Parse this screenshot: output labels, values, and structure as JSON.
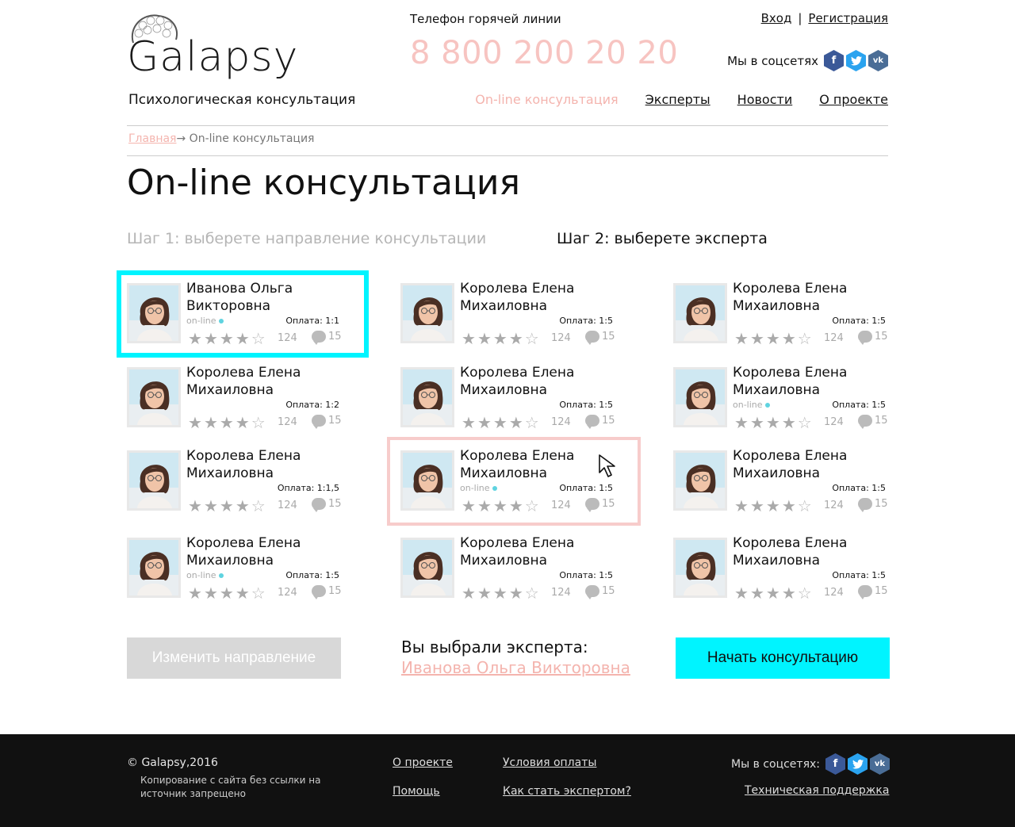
{
  "brand": {
    "name": "Galapsy",
    "tagline": "Психологическая консультация"
  },
  "hotline": {
    "label": "Телефон горячей линии",
    "phone": "8 800 200 20 20"
  },
  "auth": {
    "login": "Вход",
    "separator": "|",
    "register": "Регистрация"
  },
  "social": {
    "label": "Мы в соцсетях",
    "networks": [
      "facebook-icon",
      "twitter-icon",
      "vk-icon"
    ]
  },
  "nav": {
    "items": [
      {
        "label": "On-line консультация",
        "active": true
      },
      {
        "label": "Эксперты",
        "active": false
      },
      {
        "label": "Новости",
        "active": false
      },
      {
        "label": "О проекте",
        "active": false
      }
    ]
  },
  "breadcrumb": {
    "home": "Главная",
    "arrow": "→",
    "current": "On-line консультация"
  },
  "page": {
    "title": "On-line консультация",
    "step1": "Шаг 1: выберете направление консультации",
    "step2": "Шаг 2: выберете эксперта"
  },
  "experts": [
    {
      "name": "Иванова Ольга Викторовна",
      "online": true,
      "online_label": "on-line",
      "pay": "Оплата: 1:1",
      "rating": 4,
      "votes": "124",
      "comments": "15"
    },
    {
      "name": "Королева Елена Михаиловна",
      "online": false,
      "online_label": "",
      "pay": "Оплата: 1:5",
      "rating": 4,
      "votes": "124",
      "comments": "15"
    },
    {
      "name": "Королева Елена Михаиловна",
      "online": false,
      "online_label": "",
      "pay": "Оплата: 1:5",
      "rating": 4,
      "votes": "124",
      "comments": "15"
    },
    {
      "name": "Королева Елена Михаиловна",
      "online": false,
      "online_label": "",
      "pay": "Оплата: 1:2",
      "rating": 4,
      "votes": "124",
      "comments": "15"
    },
    {
      "name": "Королева Елена Михаиловна",
      "online": false,
      "online_label": "",
      "pay": "Оплата: 1:5",
      "rating": 4,
      "votes": "124",
      "comments": "15"
    },
    {
      "name": "Королева Елена Михаиловна",
      "online": true,
      "online_label": "on-line",
      "pay": "Оплата: 1:5",
      "rating": 4,
      "votes": "124",
      "comments": "15"
    },
    {
      "name": "Королева Елена Михаиловна",
      "online": false,
      "online_label": "",
      "pay": "Оплата: 1:1,5",
      "rating": 4,
      "votes": "124",
      "comments": "15"
    },
    {
      "name": "Королева Елена Михаиловна",
      "online": true,
      "online_label": "on-line",
      "pay": "Оплата: 1:5",
      "rating": 4,
      "votes": "124",
      "comments": "15"
    },
    {
      "name": "Королева Елена Михаиловна",
      "online": false,
      "online_label": "",
      "pay": "Оплата: 1:5",
      "rating": 4,
      "votes": "124",
      "comments": "15"
    },
    {
      "name": "Королева Елена Михаиловна",
      "online": true,
      "online_label": "on-line",
      "pay": "Оплата: 1:5",
      "rating": 4,
      "votes": "124",
      "comments": "15"
    },
    {
      "name": "Королева Елена Михаиловна",
      "online": false,
      "online_label": "",
      "pay": "Оплата: 1:5",
      "rating": 4,
      "votes": "124",
      "comments": "15"
    },
    {
      "name": "Королева Елена Михаиловна",
      "online": false,
      "online_label": "",
      "pay": "Оплата: 1:5",
      "rating": 4,
      "votes": "124",
      "comments": "15"
    }
  ],
  "selection": {
    "chosen_label": "Вы выбрали эксперта:",
    "chosen_name": "Иванова Ольга Викторовна",
    "change_button": "Изменить направление",
    "start_button": "Начать консультацию"
  },
  "footer": {
    "copyright": "© Galapsy,2016",
    "copy_note": "Копирование с сайта без ссылки на источник запрещено",
    "links": {
      "about": "О проекте",
      "payment": "Условия оплаты",
      "help": "Помощь",
      "become_expert": "Как стать экспертом?",
      "support": "Техническая поддержка"
    },
    "social_label": "Мы в соцсетях:"
  },
  "colors": {
    "accent_pink": "#f4b4ae",
    "accent_cyan": "#00f4ff",
    "footer_bg": "#111111",
    "online_dot": "#5fd3e0"
  }
}
